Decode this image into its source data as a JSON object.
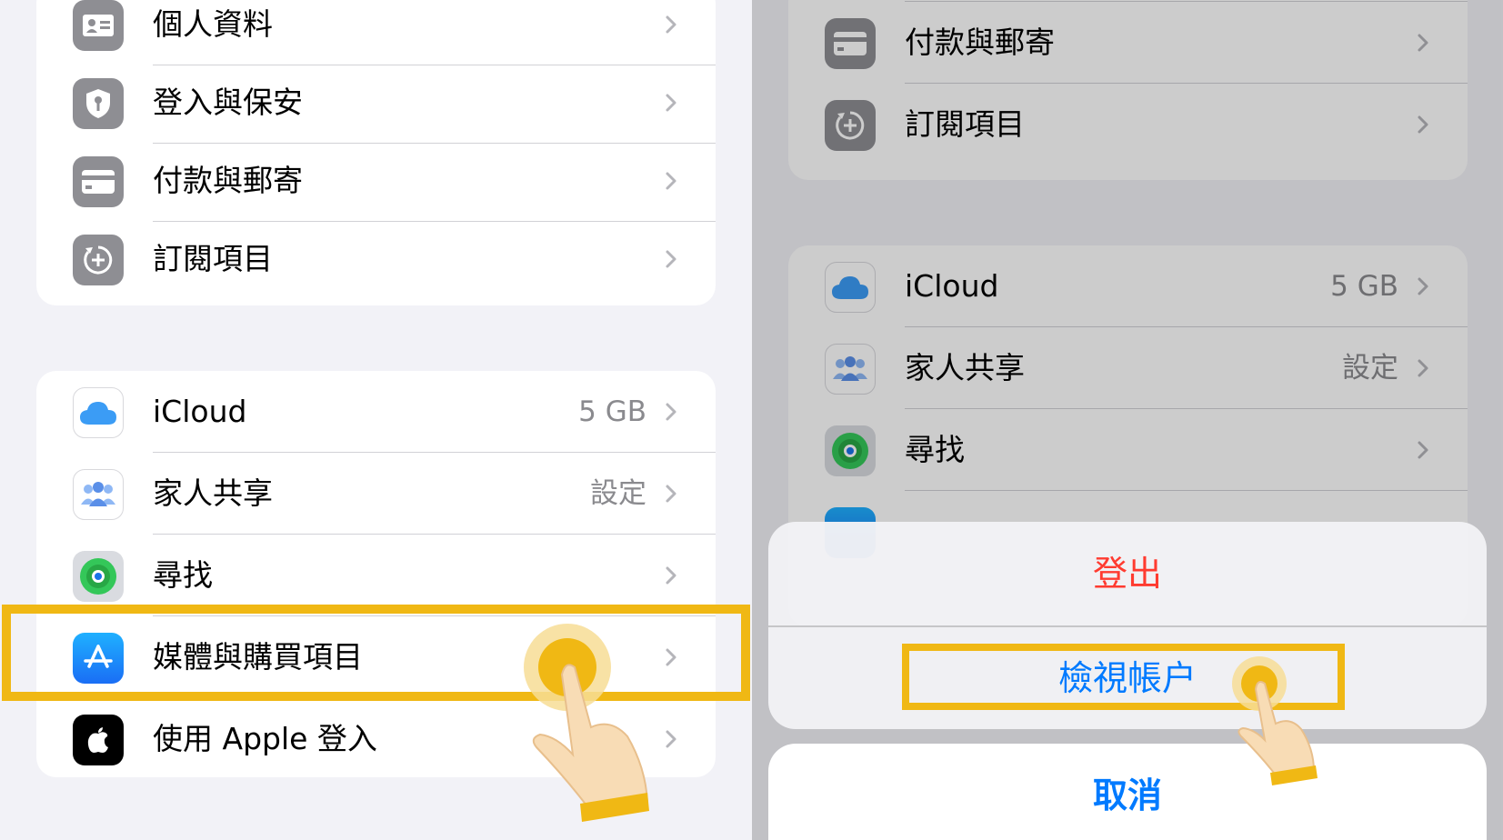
{
  "left": {
    "account_group": [
      {
        "label": "個人資料",
        "icon": "id-card-icon"
      },
      {
        "label": "登入與保安",
        "icon": "shield-key-icon"
      },
      {
        "label": "付款與郵寄",
        "icon": "credit-card-icon"
      },
      {
        "label": "訂閱項目",
        "icon": "subscription-icon"
      }
    ],
    "services_group": [
      {
        "label": "iCloud",
        "value": "5 GB",
        "icon": "icloud-icon"
      },
      {
        "label": "家人共享",
        "value": "設定",
        "icon": "family-icon"
      },
      {
        "label": "尋找",
        "value": "",
        "icon": "find-my-icon"
      },
      {
        "label": "媒體與購買項目",
        "value": "",
        "icon": "app-store-icon"
      },
      {
        "label": "使用 Apple 登入",
        "value": "",
        "icon": "apple-icon"
      }
    ]
  },
  "right": {
    "account_group": [
      {
        "label": "付款與郵寄",
        "icon": "credit-card-icon"
      },
      {
        "label": "訂閱項目",
        "icon": "subscription-icon"
      }
    ],
    "services_group": [
      {
        "label": "iCloud",
        "value": "5 GB",
        "icon": "icloud-icon"
      },
      {
        "label": "家人共享",
        "value": "設定",
        "icon": "family-icon"
      },
      {
        "label": "尋找",
        "value": "",
        "icon": "find-my-icon"
      }
    ],
    "action_sheet": {
      "sign_out": "登出",
      "view_account": "檢視帳户",
      "cancel": "取消"
    }
  },
  "colors": {
    "highlight": "#f0b814",
    "destructive": "#ff3b30",
    "link": "#007aff",
    "background": "#f2f2f7"
  }
}
